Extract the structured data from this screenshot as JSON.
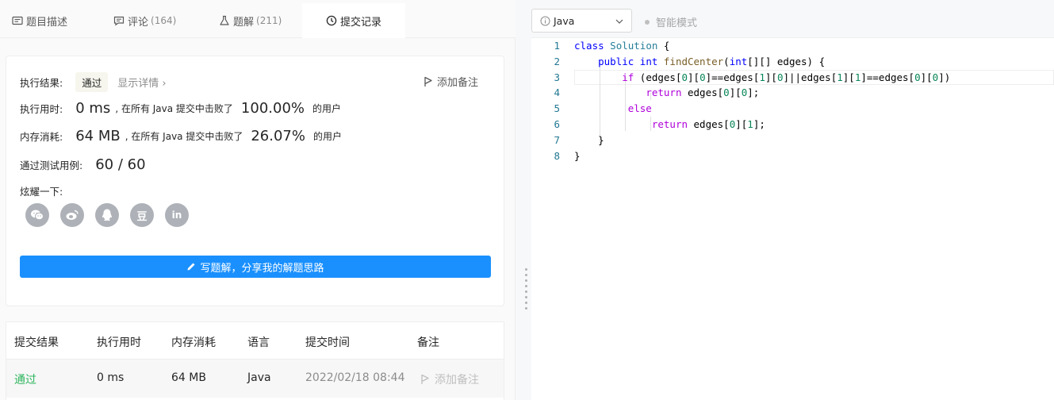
{
  "tabs": [
    {
      "label": "题目描述",
      "count": "",
      "icon": "description-icon"
    },
    {
      "label": "评论",
      "count": "(164)",
      "icon": "comment-icon"
    },
    {
      "label": "题解",
      "count": "(211)",
      "icon": "flask-icon"
    },
    {
      "label": "提交记录",
      "count": "",
      "icon": "clock-icon",
      "active": true
    }
  ],
  "result": {
    "label": "执行结果:",
    "status": "通过",
    "detail_link": "显示详情 ›",
    "add_note": "添加备注",
    "time_label": "执行用时:",
    "time_value": "0 ms",
    "time_text": ", 在所有 Java 提交中击败了",
    "time_pct": "100.00%",
    "time_suffix": "的用户",
    "mem_label": "内存消耗:",
    "mem_value": "64 MB",
    "mem_text": ", 在所有 Java 提交中击败了",
    "mem_pct": "26.07%",
    "mem_suffix": "的用户",
    "cases_label": "通过测试用例:",
    "cases_value": "60 / 60",
    "share_label": "炫耀一下:",
    "share_icons": [
      "wechat-icon",
      "weibo-icon",
      "qq-icon",
      "douban-icon",
      "linkedin-icon"
    ],
    "douban_text": "豆",
    "linkedin_text": "in",
    "write_button": "写题解，分享我的解题思路"
  },
  "table": {
    "headers": [
      "提交结果",
      "执行用时",
      "内存消耗",
      "语言",
      "提交时间",
      "备注"
    ],
    "rows": [
      {
        "result": "通过",
        "time": "0 ms",
        "memory": "64 MB",
        "lang": "Java",
        "submitted": "2022/02/18 08:44",
        "note": "添加备注"
      }
    ]
  },
  "editor": {
    "language": "Java",
    "mode": "智能模式",
    "line_numbers": [
      "1",
      "2",
      "3",
      "4",
      "5",
      "6",
      "7",
      "8"
    ]
  },
  "colors": {
    "accent": "#1a90ff",
    "success": "#2db55d",
    "muted": "#8c8c8c"
  }
}
